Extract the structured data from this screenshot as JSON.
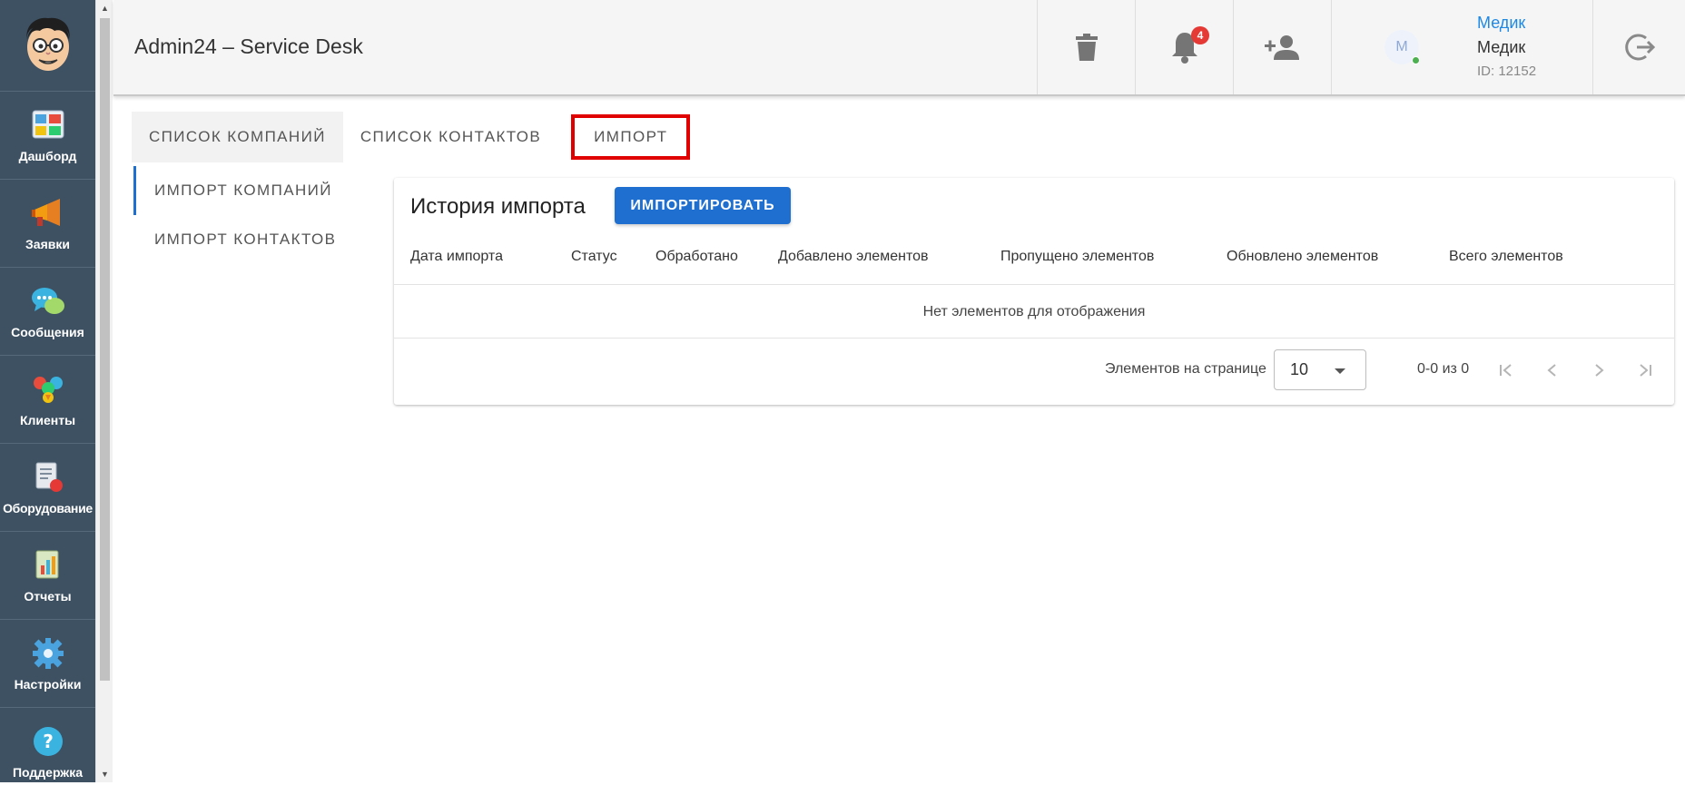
{
  "app": {
    "title": "Admin24 – Service Desk"
  },
  "sidebar": {
    "items": [
      {
        "label": "Дашборд",
        "icon": "dashboard-icon"
      },
      {
        "label": "Заявки",
        "icon": "megaphone-icon"
      },
      {
        "label": "Сообщения",
        "icon": "chat-icon"
      },
      {
        "label": "Клиенты",
        "icon": "clients-icon"
      },
      {
        "label": "Оборудование",
        "icon": "equipment-icon"
      },
      {
        "label": "Отчеты",
        "icon": "reports-icon"
      },
      {
        "label": "Настройки",
        "icon": "gear-icon"
      },
      {
        "label": "Поддержка",
        "icon": "help-icon"
      }
    ]
  },
  "header": {
    "notification_count": "4",
    "user": {
      "avatar_letter": "М",
      "link_name": "Медик",
      "name": "Медик",
      "id": "ID: 12152"
    }
  },
  "tabs": [
    {
      "label": "СПИСОК КОМПАНИЙ"
    },
    {
      "label": "СПИСОК КОНТАКТОВ"
    },
    {
      "label": "ИМПОРТ"
    }
  ],
  "subnav": [
    {
      "label": "ИМПОРТ КОМПАНИЙ"
    },
    {
      "label": "ИМПОРТ КОНТАКТОВ"
    }
  ],
  "card": {
    "title": "История импорта",
    "import_button": "ИМПОРТИРОВАТЬ",
    "columns": [
      "Дата импорта",
      "Статус",
      "Обработано",
      "Добавлено элементов",
      "Пропущено элементов",
      "Обновлено элементов",
      "Всего элементов"
    ],
    "empty_text": "Нет элементов для отображения",
    "pager": {
      "per_page_label": "Элементов на странице",
      "per_page_value": "10",
      "range": "0-0 из 0"
    }
  },
  "colors": {
    "sidebar": "#3d5163",
    "accent": "#1e6fd0",
    "highlight": "#e00000",
    "badge": "#e53935"
  }
}
